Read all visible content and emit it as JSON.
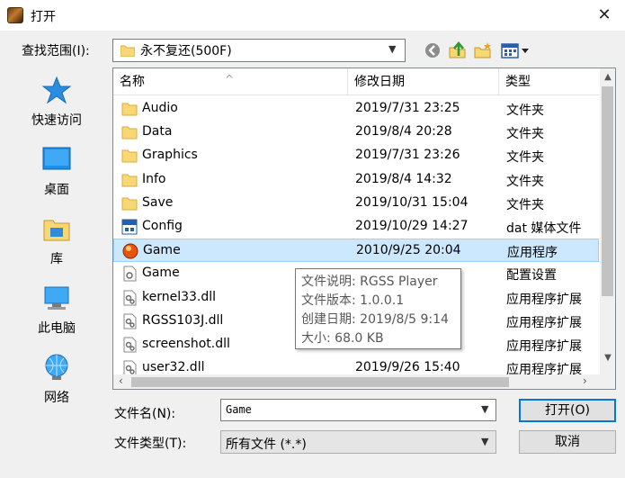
{
  "window": {
    "title": "打开",
    "close_glyph": "✕"
  },
  "lookin": {
    "label": "查找范围(I):",
    "value": "永不复还(500F)"
  },
  "places": [
    {
      "label": "快速访问",
      "icon": "star-icon"
    },
    {
      "label": "桌面",
      "icon": "desktop-icon"
    },
    {
      "label": "库",
      "icon": "library-icon"
    },
    {
      "label": "此电脑",
      "icon": "computer-icon"
    },
    {
      "label": "网络",
      "icon": "network-icon"
    }
  ],
  "columns": {
    "name": "名称",
    "date": "修改日期",
    "type": "类型"
  },
  "files": [
    {
      "name": "Audio",
      "date": "2019/7/31 23:25",
      "type": "文件夹",
      "icon": "folder"
    },
    {
      "name": "Data",
      "date": "2019/8/4 20:28",
      "type": "文件夹",
      "icon": "folder"
    },
    {
      "name": "Graphics",
      "date": "2019/7/31 23:26",
      "type": "文件夹",
      "icon": "folder"
    },
    {
      "name": "Info",
      "date": "2019/8/4 14:32",
      "type": "文件夹",
      "icon": "folder"
    },
    {
      "name": "Save",
      "date": "2019/10/31 15:04",
      "type": "文件夹",
      "icon": "folder"
    },
    {
      "name": "Config",
      "date": "2019/10/29 14:27",
      "type": "dat 媒体文件",
      "icon": "dat"
    },
    {
      "name": "Game",
      "date": "2010/9/25 20:04",
      "type": "应用程序",
      "icon": "exe",
      "selected": true
    },
    {
      "name": "Game",
      "date": "",
      "type": "配置设置",
      "icon": "ini"
    },
    {
      "name": "kernel33.dll",
      "date": "",
      "type": "应用程序扩展",
      "icon": "dll"
    },
    {
      "name": "RGSS103J.dll",
      "date": "",
      "type": "应用程序扩展",
      "icon": "dll"
    },
    {
      "name": "screenshot.dll",
      "date": "",
      "type": "应用程序扩展",
      "icon": "dll"
    },
    {
      "name": "user32.dll",
      "date": "2019/9/26 15:40",
      "type": "应用程序扩展",
      "icon": "dll"
    }
  ],
  "tooltip": [
    "文件说明: RGSS Player",
    "文件版本: 1.0.0.1",
    "创建日期: 2019/8/5 9:14",
    "大小: 68.0 KB"
  ],
  "filename": {
    "label": "文件名(N):",
    "value": "Game"
  },
  "filetype": {
    "label": "文件类型(T):",
    "value": "所有文件 (*.*)"
  },
  "buttons": {
    "open": "打开(O)",
    "cancel": "取消"
  },
  "colors": {
    "selection": "#cce8ff",
    "folder": "#f8d775",
    "accent": "#0078d7"
  }
}
